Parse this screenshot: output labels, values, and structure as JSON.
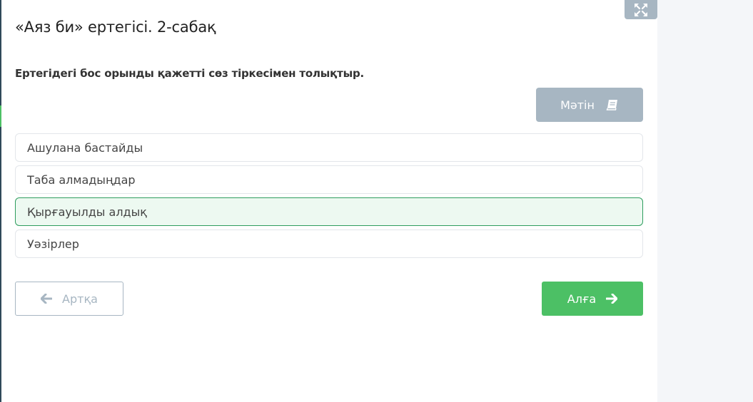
{
  "page": {
    "title": "«Аяз би» ертегісі. 2-сабақ",
    "instruction": "Ертегідегі бос орынды қажетті сөз тіркесімен толықтыр."
  },
  "toolbar": {
    "text_button_label": "Мәтін",
    "text_button_icon": "book-icon",
    "fullscreen_icon": "expand-arrows-icon"
  },
  "options": [
    {
      "label": "Ашулана бастайды",
      "selected": false
    },
    {
      "label": "Таба алмадыңдар",
      "selected": false
    },
    {
      "label": "Қырғауылды алдық",
      "selected": true
    },
    {
      "label": "Уәзірлер",
      "selected": false
    }
  ],
  "navigation": {
    "back_label": "Артқа",
    "next_label": "Алға"
  },
  "colors": {
    "accent_green": "#4cc065",
    "selected_bg": "#edf9f1",
    "selected_border": "#2e9d5e",
    "muted_gray": "#a7b6c2"
  }
}
